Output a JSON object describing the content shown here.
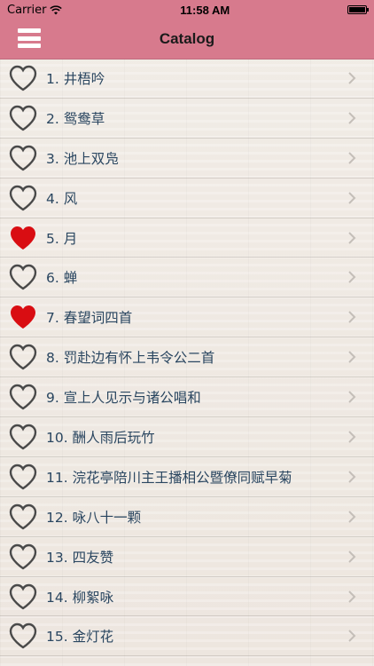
{
  "status_bar": {
    "carrier": "Carrier",
    "time": "11:58 AM"
  },
  "navbar": {
    "title": "Catalog",
    "menu_icon": "hamburger-menu-icon"
  },
  "colors": {
    "bar_pink": "#d77a8d",
    "heart_red": "#d90d12",
    "heart_outline": "#4a4a4a",
    "text_blue": "#2a4660"
  },
  "items": [
    {
      "label": "1. 井梧吟",
      "favorite": false
    },
    {
      "label": "2. 鸳鸯草",
      "favorite": false
    },
    {
      "label": "3. 池上双凫",
      "favorite": false
    },
    {
      "label": "4. 风",
      "favorite": false
    },
    {
      "label": "5. 月",
      "favorite": true
    },
    {
      "label": "6. 蝉",
      "favorite": false
    },
    {
      "label": "7. 春望词四首",
      "favorite": true
    },
    {
      "label": "8. 罚赴边有怀上韦令公二首",
      "favorite": false
    },
    {
      "label": "9. 宣上人见示与诸公唱和",
      "favorite": false
    },
    {
      "label": "10. 酬人雨后玩竹",
      "favorite": false
    },
    {
      "label": "11. 浣花亭陪川主王播相公暨僚同赋早菊",
      "favorite": false
    },
    {
      "label": "12. 咏八十一颗",
      "favorite": false
    },
    {
      "label": "13. 四友赞",
      "favorite": false
    },
    {
      "label": "14. 柳絮咏",
      "favorite": false
    },
    {
      "label": "15. 金灯花",
      "favorite": false
    }
  ]
}
